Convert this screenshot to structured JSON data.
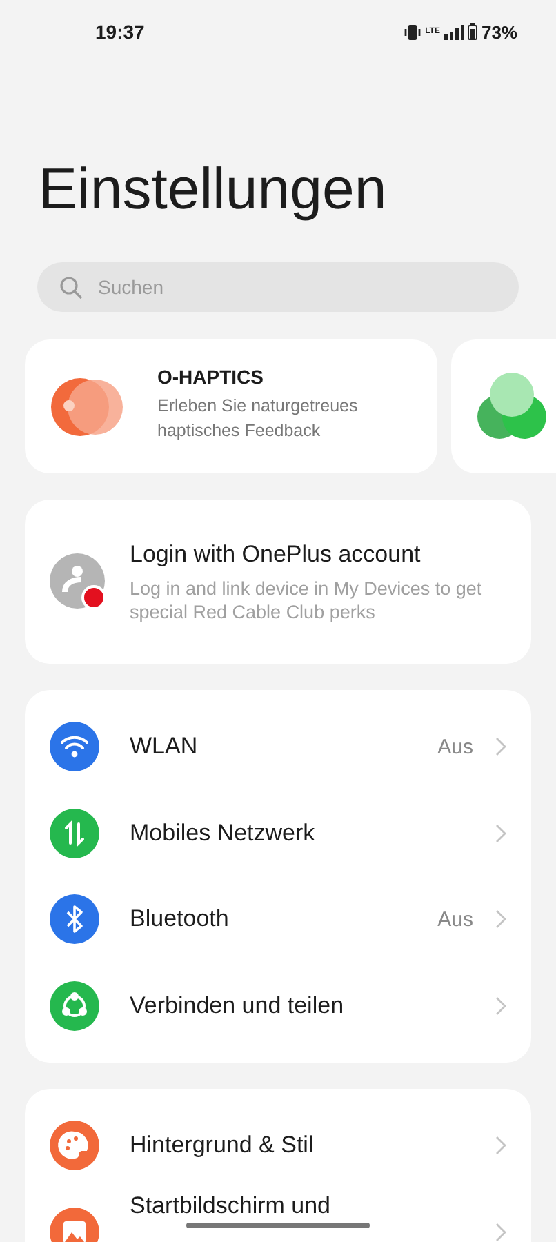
{
  "status_bar": {
    "time": "19:37",
    "network": "LTE",
    "battery": "73%"
  },
  "title": "Einstellungen",
  "search": {
    "placeholder": "Suchen"
  },
  "feature_cards": [
    {
      "kind": "haptics",
      "title": "O-HAPTICS",
      "subtitle": "Erleben Sie naturgetreues haptisches Feedback"
    },
    {
      "kind": "green"
    }
  ],
  "account": {
    "title": "Login with OnePlus account",
    "subtitle": "Log in and link device in My Devices to get special Red Cable Club perks"
  },
  "groups": [
    {
      "items": [
        {
          "kind": "wifi",
          "color": "#2b74e8",
          "label": "WLAN",
          "value": "Aus"
        },
        {
          "kind": "mobile",
          "color": "#25b84e",
          "label": "Mobiles Netzwerk"
        },
        {
          "kind": "bluetooth",
          "color": "#2b74e8",
          "label": "Bluetooth",
          "value": "Aus"
        },
        {
          "kind": "share",
          "color": "#25b84e",
          "label": "Verbinden und teilen"
        }
      ]
    },
    {
      "items": [
        {
          "kind": "palette",
          "color": "#f2693a",
          "label": "Hintergrund & Stil"
        },
        {
          "kind": "image",
          "color": "#f2693a",
          "label": "Startbildschirm und"
        }
      ]
    }
  ]
}
